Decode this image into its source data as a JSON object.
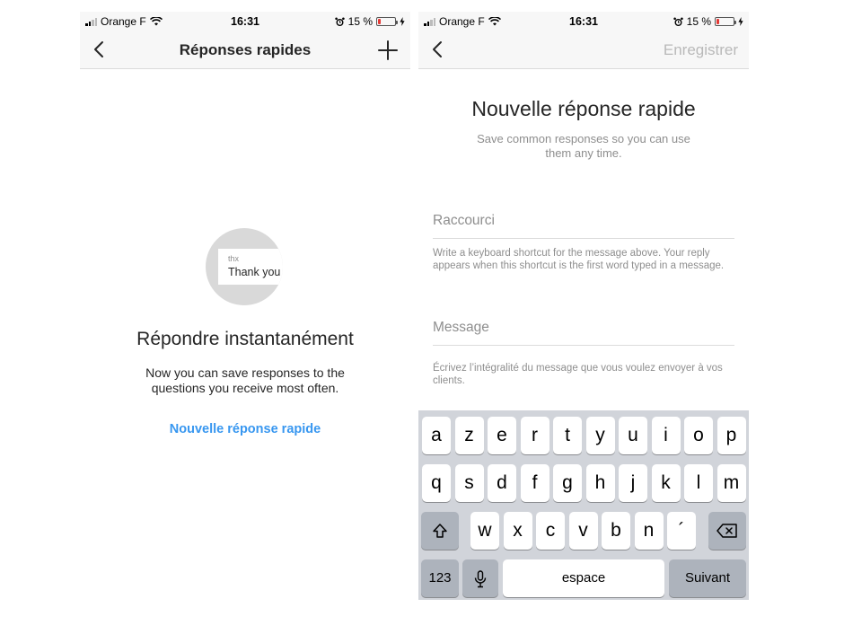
{
  "status_bar": {
    "carrier": "Orange F",
    "time": "16:31",
    "battery": "15 %",
    "battery_level": 0.15
  },
  "left_screen": {
    "nav": {
      "title": "Réponses rapides"
    },
    "illustration": {
      "shortcut": "thx",
      "message": "Thank you"
    },
    "empty_state": {
      "title": "Répondre instantanément",
      "subtitle": "Now you can save responses to the questions you receive most often.",
      "link": "Nouvelle réponse rapide"
    }
  },
  "right_screen": {
    "nav": {
      "save": "Enregistrer"
    },
    "title": "Nouvelle réponse rapide",
    "subtitle": "Save common responses so you can use them any time.",
    "shortcut_field": {
      "placeholder": "Raccourci",
      "value": "",
      "hint": "Write a keyboard shortcut for the message above. Your reply appears when this shortcut is the first word typed in a message."
    },
    "message_field": {
      "placeholder": "Message",
      "value": "",
      "hint": "Écrivez l’intégralité du message que vous voulez envoyer à vos clients."
    }
  },
  "keyboard": {
    "row1": [
      "a",
      "z",
      "e",
      "r",
      "t",
      "y",
      "u",
      "i",
      "o",
      "p"
    ],
    "row2": [
      "q",
      "s",
      "d",
      "f",
      "g",
      "h",
      "j",
      "k",
      "l",
      "m"
    ],
    "row3": [
      "w",
      "x",
      "c",
      "v",
      "b",
      "n",
      "´"
    ],
    "numbers": "123",
    "space": "espace",
    "return": "Suivant"
  },
  "colors": {
    "accent": "#3897f0",
    "disabled": "#b9b9b9",
    "battery_low": "#e53935",
    "keyboard_bg": "#d1d4da"
  }
}
